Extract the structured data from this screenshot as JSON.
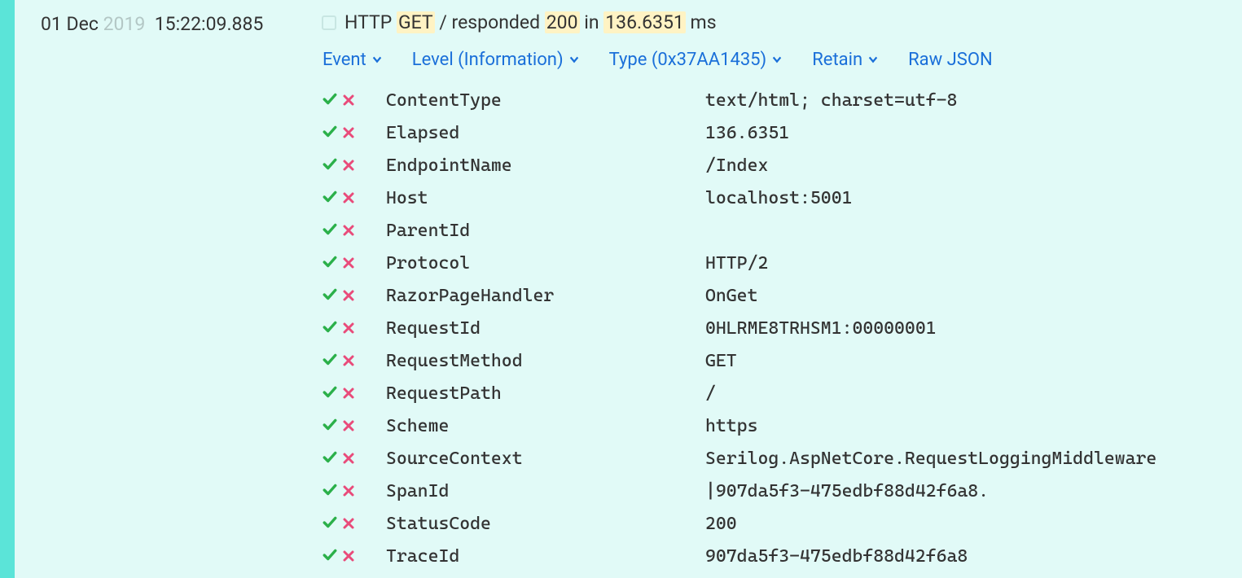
{
  "timestamp": {
    "date_prefix": "01 Dec",
    "year": "2019",
    "time": "15:22:09.885"
  },
  "message": {
    "p1": "HTTP ",
    "method": "GET",
    "p2": " / responded ",
    "status": "200",
    "p3": " in ",
    "elapsed": "136.6351",
    "p4": " ms"
  },
  "actions": {
    "event": "Event",
    "level": "Level (Information)",
    "type": "Type (0x37AA1435)",
    "retain": "Retain",
    "raw_json": "Raw JSON"
  },
  "properties": [
    {
      "name": "ContentType",
      "value": "text/html; charset=utf-8"
    },
    {
      "name": "Elapsed",
      "value": "136.6351"
    },
    {
      "name": "EndpointName",
      "value": "/Index"
    },
    {
      "name": "Host",
      "value": "localhost:5001"
    },
    {
      "name": "ParentId",
      "value": ""
    },
    {
      "name": "Protocol",
      "value": "HTTP/2"
    },
    {
      "name": "RazorPageHandler",
      "value": "OnGet"
    },
    {
      "name": "RequestId",
      "value": "0HLRME8TRHSM1:00000001"
    },
    {
      "name": "RequestMethod",
      "value": "GET"
    },
    {
      "name": "RequestPath",
      "value": "/"
    },
    {
      "name": "Scheme",
      "value": "https"
    },
    {
      "name": "SourceContext",
      "value": "Serilog.AspNetCore.RequestLoggingMiddleware"
    },
    {
      "name": "SpanId",
      "value": "|907da5f3-475edbf88d42f6a8."
    },
    {
      "name": "StatusCode",
      "value": "200"
    },
    {
      "name": "TraceId",
      "value": "907da5f3-475edbf88d42f6a8"
    }
  ]
}
